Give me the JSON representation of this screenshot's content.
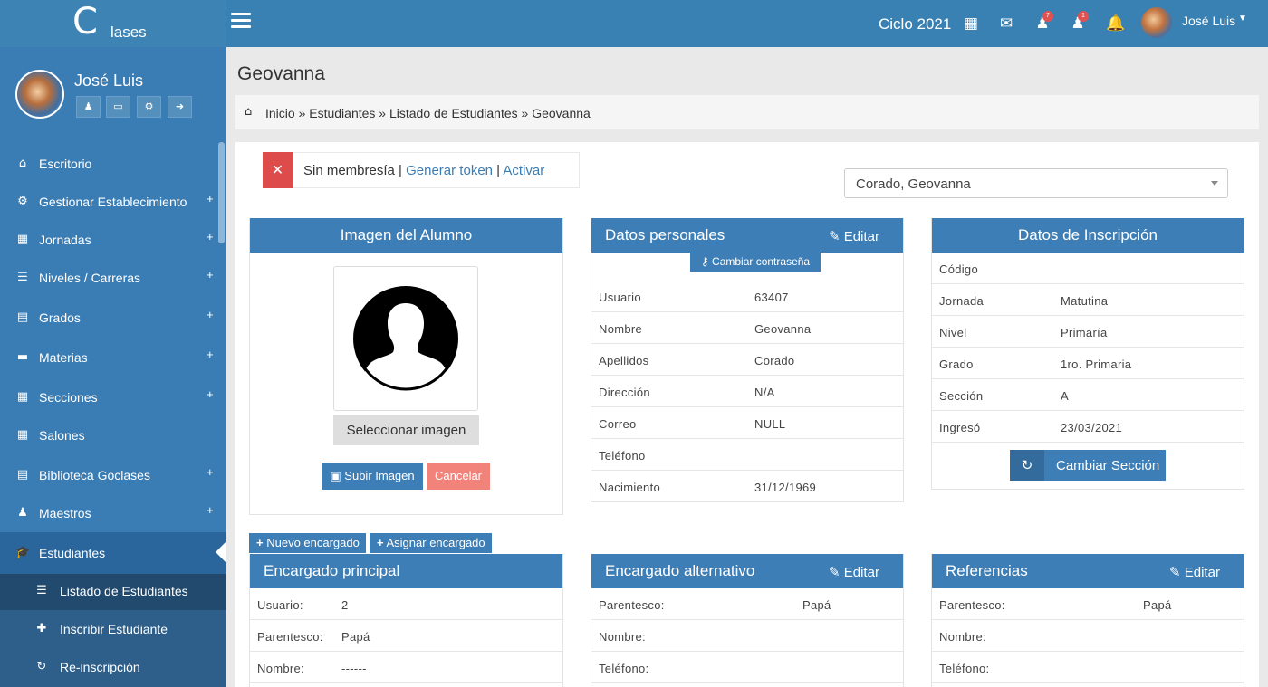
{
  "app": {
    "logo_mark": "C",
    "logo_text": "lases"
  },
  "topbar": {
    "cycle": "Ciclo 2021",
    "badge_students": "7",
    "badge_groups": "1",
    "user_name": "José Luis",
    "icons": [
      "calendar-icon",
      "envelope-icon",
      "user-icon",
      "users-icon",
      "bell-icon"
    ]
  },
  "sidebar": {
    "user_name": "José Luis",
    "items": [
      {
        "label": "Escritorio",
        "icon": "⌂",
        "expand": ""
      },
      {
        "label": "Gestionar Establecimiento",
        "icon": "⚙",
        "expand": "+"
      },
      {
        "label": "Jornadas",
        "icon": "▦",
        "expand": "+"
      },
      {
        "label": "Niveles / Carreras",
        "icon": "☰",
        "expand": "+"
      },
      {
        "label": "Grados",
        "icon": "▤",
        "expand": "+"
      },
      {
        "label": "Materias",
        "icon": "▬",
        "expand": "+"
      },
      {
        "label": "Secciones",
        "icon": "▦",
        "expand": "+"
      },
      {
        "label": "Salones",
        "icon": "▦",
        "expand": ""
      },
      {
        "label": "Biblioteca Goclases",
        "icon": "▤",
        "expand": "+"
      },
      {
        "label": "Maestros",
        "icon": "♟",
        "expand": "+"
      },
      {
        "label": "Estudiantes",
        "icon": "🎓",
        "expand": ""
      }
    ],
    "submenu": [
      {
        "label": "Listado de Estudiantes",
        "icon": "☰"
      },
      {
        "label": "Inscribir Estudiante",
        "icon": "✚"
      },
      {
        "label": "Re-inscripción",
        "icon": "↻"
      }
    ]
  },
  "page": {
    "title": "Geovanna",
    "breadcrumb": "Inicio » Estudiantes » Listado de Estudiantes » Geovanna"
  },
  "alert": {
    "text": "Sin membresía |",
    "link1": "Generar token",
    "sep": "|",
    "link2": "Activar"
  },
  "student_select": {
    "value": "Corado, Geovanna"
  },
  "image_box": {
    "title": "Imagen del Alumno",
    "select_label": "Seleccionar imagen",
    "upload_label": "Subir Imagen",
    "cancel_label": "Cancelar"
  },
  "personal": {
    "title": "Datos personales",
    "edit": "Editar",
    "change_password": "Cambiar contraseña",
    "rows": [
      {
        "k": "Usuario",
        "v": "63407"
      },
      {
        "k": "Nombre",
        "v": "Geovanna"
      },
      {
        "k": "Apellidos",
        "v": "Corado"
      },
      {
        "k": "Dirección",
        "v": "N/A"
      },
      {
        "k": "Correo",
        "v": "NULL"
      },
      {
        "k": "Teléfono",
        "v": ""
      },
      {
        "k": "Nacimiento",
        "v": "31/12/1969"
      }
    ]
  },
  "enrollment": {
    "title": "Datos de Inscripción",
    "change_section": "Cambiar Sección",
    "rows": [
      {
        "k": "Código",
        "v": ""
      },
      {
        "k": "Jornada",
        "v": "Matutina"
      },
      {
        "k": "Nivel",
        "v": "Primaría"
      },
      {
        "k": "Grado",
        "v": "1ro. Primaria"
      },
      {
        "k": "Sección",
        "v": "A"
      },
      {
        "k": "Ingresó",
        "v": "23/03/2021"
      }
    ]
  },
  "guardian_buttons": {
    "new": "Nuevo encargado",
    "assign": "Asignar encargado"
  },
  "guardian_main": {
    "title": "Encargado principal",
    "rows": [
      {
        "k": "Usuario:",
        "v": "2"
      },
      {
        "k": "Parentesco:",
        "v": "Papá"
      },
      {
        "k": "Nombre:",
        "v": "------"
      }
    ]
  },
  "guardian_alt": {
    "title": "Encargado alternativo",
    "edit": "Editar",
    "rows": [
      {
        "k": "Parentesco:",
        "v": "Papá"
      },
      {
        "k": "Nombre:",
        "v": ""
      },
      {
        "k": "Teléfono:",
        "v": ""
      }
    ]
  },
  "references": {
    "title": "Referencias",
    "edit": "Editar",
    "rows": [
      {
        "k": "Parentesco:",
        "v": "Papá"
      },
      {
        "k": "Nombre:",
        "v": ""
      },
      {
        "k": "Teléfono:",
        "v": ""
      }
    ]
  },
  "colors": {
    "primary": "#3d7eb6",
    "sidebar": "#3a7db5",
    "danger": "#dd4b4b",
    "cancel": "#f2837a"
  }
}
